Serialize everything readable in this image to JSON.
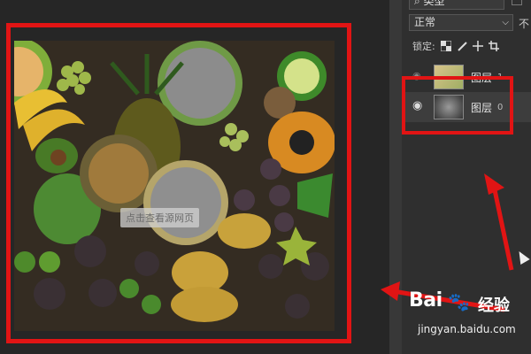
{
  "panel": {
    "filter_kind": "类型",
    "blend_mode": "正常",
    "opacity_label_cut": "不",
    "lock_label": "锁定:",
    "layers": [
      {
        "name": "图层",
        "num": "1"
      },
      {
        "name": "图层",
        "num": "0"
      }
    ]
  },
  "canvas": {
    "watermark": "点击查看源网页"
  },
  "branding": {
    "logo": "Bai",
    "logo_suffix": "经验",
    "url": "jingyan.baidu.com"
  },
  "colors": {
    "annotation": "#e11414",
    "panel_bg": "#2f2f2f",
    "canvas_bg": "#262626"
  },
  "icons": [
    "eye-icon",
    "lock-checker-icon",
    "brush-icon",
    "move-icon",
    "crop-icon",
    "chevron-down-icon"
  ]
}
